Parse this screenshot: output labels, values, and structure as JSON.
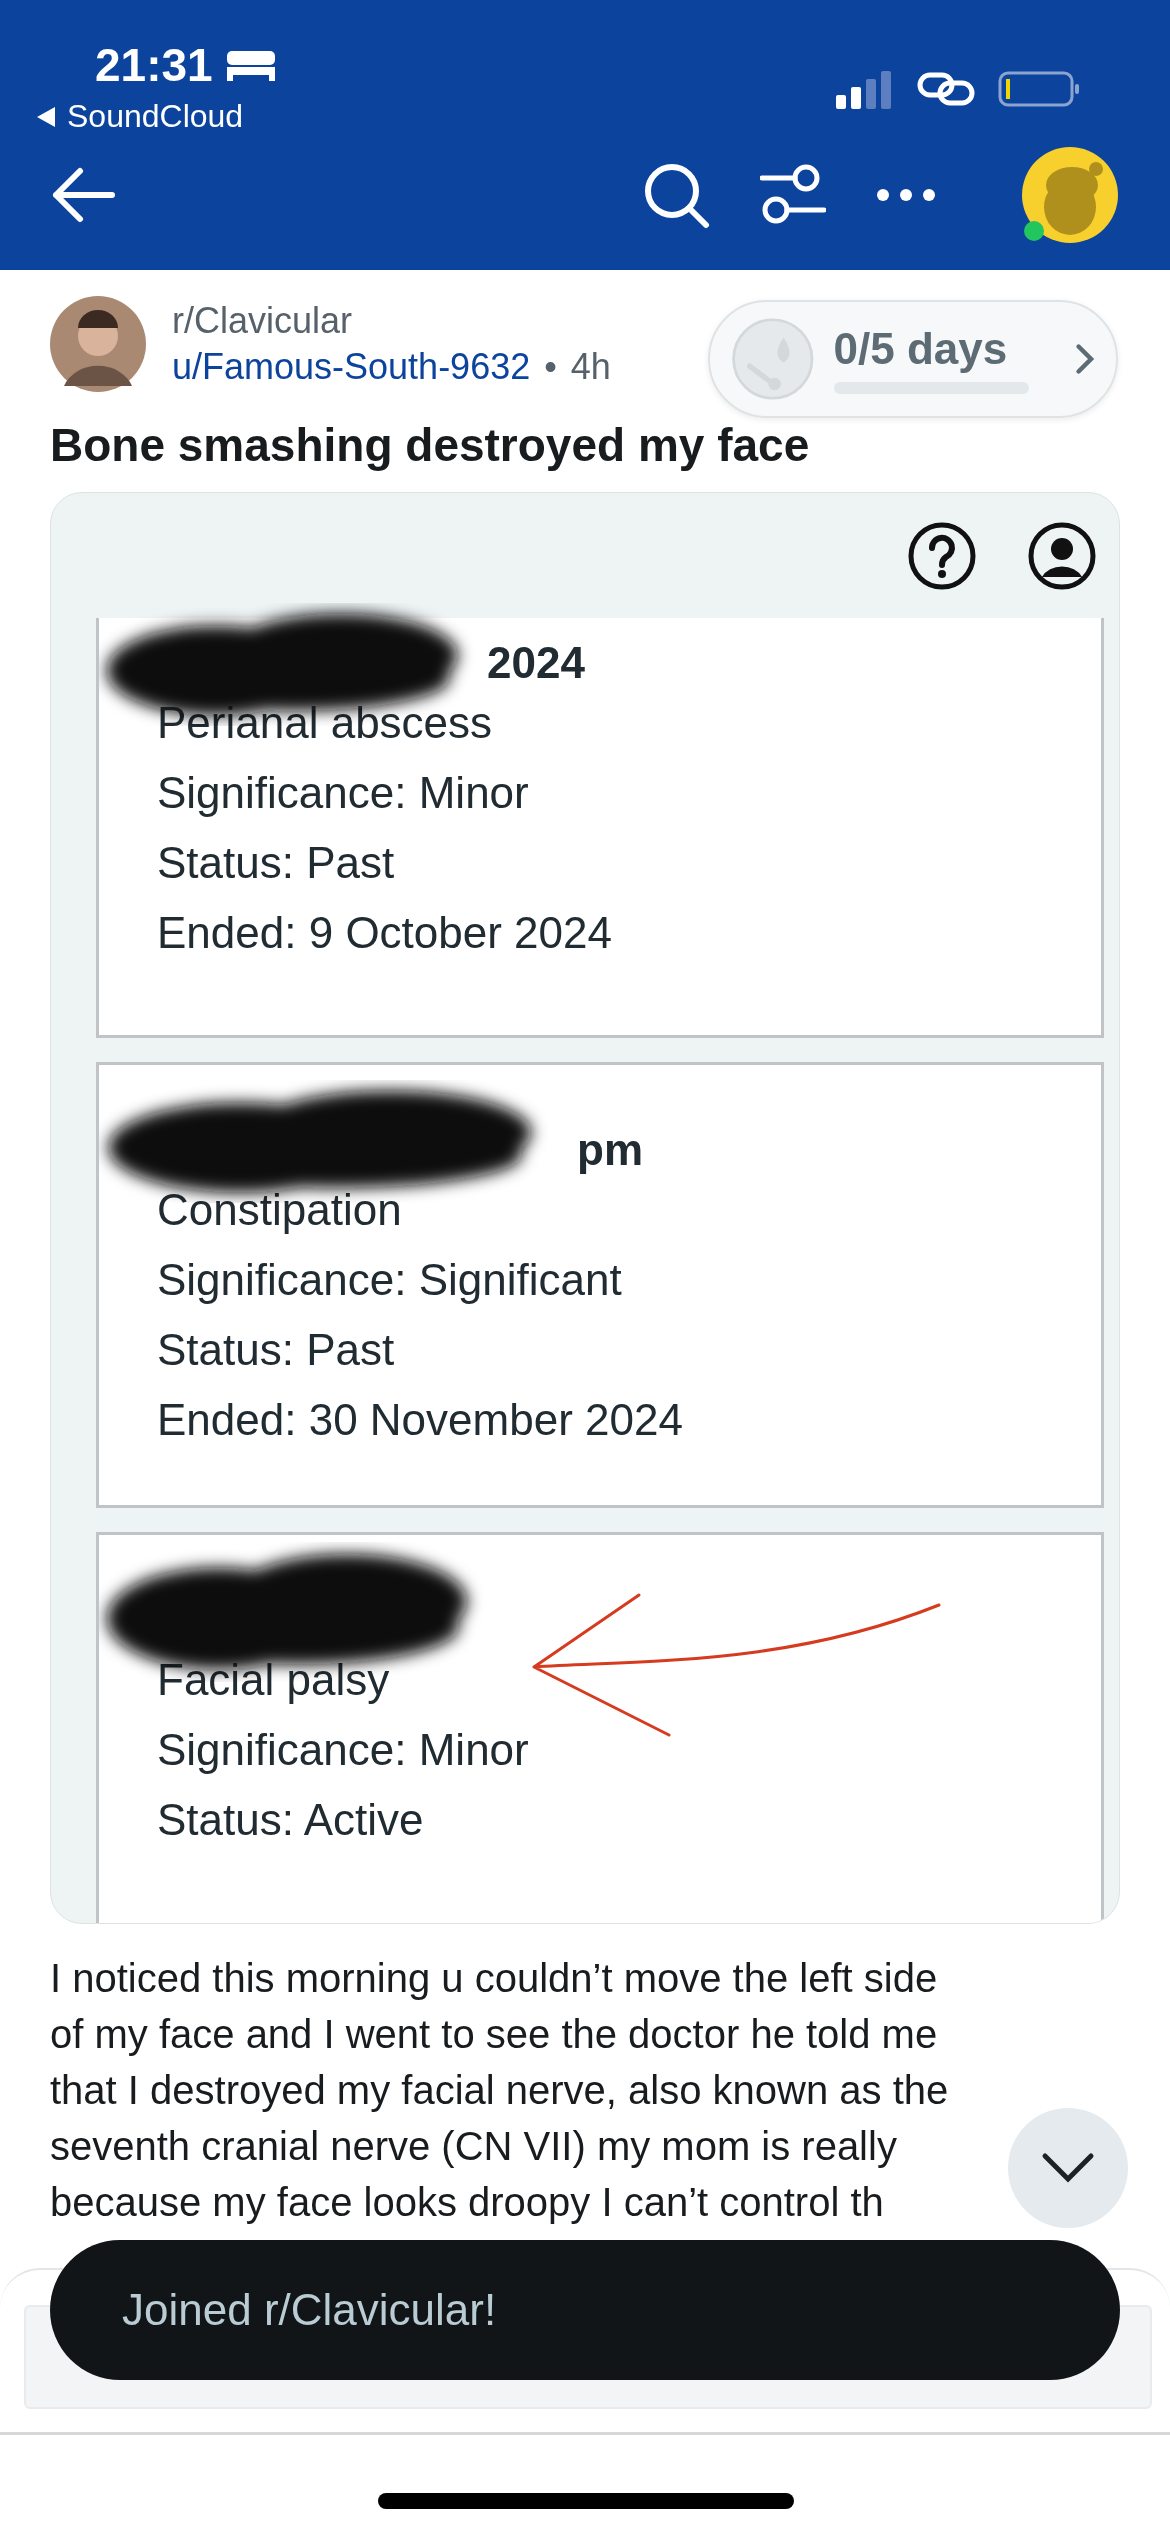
{
  "status_bar": {
    "time": "21:31",
    "back_app": "SoundCloud"
  },
  "post": {
    "subreddit": "r/Clavicular",
    "author": "u/Famous-South-9632",
    "separator": "•",
    "age": "4h",
    "title": "Bone smashing destroyed my face"
  },
  "streak": {
    "label": "0/5 days",
    "level": 0
  },
  "records": [
    {
      "date_fragment": "2024",
      "lines": [
        "Perianal abscess",
        "Significance: Minor",
        "Status: Past",
        "Ended: 9 October 2024"
      ],
      "marked": false
    },
    {
      "date_fragment": "pm",
      "lines": [
        "Constipation",
        "Significance: Significant",
        "Status: Past",
        "Ended: 30 November 2024"
      ],
      "marked": false
    },
    {
      "lines": [
        "Facial palsy",
        "Significance: Minor",
        "Status: Active"
      ],
      "marked": true
    }
  ],
  "body_lines": [
    "I noticed this morning u couldn’t move the left side",
    "of my face and I went to see the doctor he told me",
    "that I destroyed my facial nerve, also known as the",
    "seventh cranial nerve (CN VII) my mom is really",
    "because my face looks droopy I can’t control th"
  ],
  "toast": "Joined r/Clavicular!"
}
